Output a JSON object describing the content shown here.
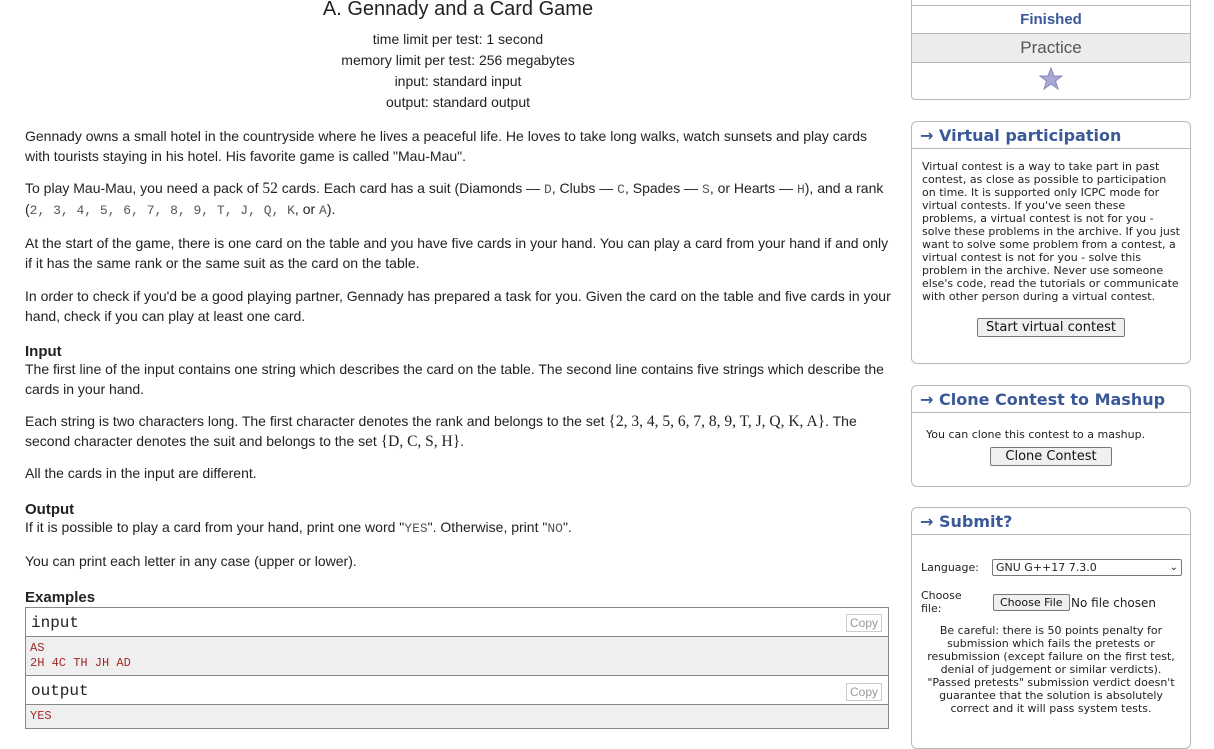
{
  "problem": {
    "title": "A. Gennady and a Card Game",
    "time_limit": "time limit per test: 1 second",
    "memory_limit": "memory limit per test: 256 megabytes",
    "input": "input: standard input",
    "output": "output: standard output"
  },
  "statement": {
    "p1": "Gennady owns a small hotel in the countryside where he lives a peaceful life. He loves to take long walks, watch sunsets and play cards with tourists staying in his hotel. His favorite game is called \"Mau-Mau\".",
    "p2_a": "To play Mau-Mau, you need a pack of ",
    "p2_52": "52",
    "p2_b": " cards. Each card has a suit (Diamonds — ",
    "p2_D": "D",
    "p2_c": ", Clubs — ",
    "p2_C": "C",
    "p2_d": ", Spades — ",
    "p2_S": "S",
    "p2_e": ", or Hearts — ",
    "p2_H": "H",
    "p2_f": "), and a rank (",
    "p2_ranks": "2, 3, 4, 5, 6, 7, 8, 9, T, J, Q, K",
    "p2_g": ", or ",
    "p2_A": "A",
    "p2_h": ").",
    "p3": "At the start of the game, there is one card on the table and you have five cards in your hand. You can play a card from your hand if and only if it has the same rank or the same suit as the card on the table.",
    "p4": "In order to check if you'd be a good playing partner, Gennady has prepared a task for you. Given the card on the table and five cards in your hand, check if you can play at least one card."
  },
  "input_section": {
    "heading": "Input",
    "p1": "The first line of the input contains one string which describes the card on the table. The second line contains five strings which describe the cards in your hand.",
    "p2_a": "Each string is two characters long. The first character denotes the rank and belongs to the set ",
    "p2_set1": "{2, 3, 4, 5, 6, 7, 8, 9, T, J, Q, K, A}",
    "p2_b": ". The second character denotes the suit and belongs to the set ",
    "p2_set2": "{D, C, S, H}",
    "p2_c": ".",
    "p3": "All the cards in the input are different."
  },
  "output_section": {
    "heading": "Output",
    "p1_a": "If it is possible to play a card from your hand, print one word \"",
    "p1_yes": "YES",
    "p1_b": "\". Otherwise, print \"",
    "p1_no": "NO",
    "p1_c": "\".",
    "p2": "You can print each letter in any case (upper or lower)."
  },
  "examples": {
    "heading": "Examples",
    "input_label": "input",
    "input_lines": [
      "AS",
      "2H 4C TH JH AD"
    ],
    "output_label": "output",
    "output_lines": [
      "YES"
    ],
    "copy_label": "Copy"
  },
  "sidebar": {
    "status": "Finished",
    "practice": "Practice",
    "virtual": {
      "title": "→ Virtual participation",
      "text": "Virtual contest is a way to take part in past contest, as close as possible to participation on time. It is supported only ICPC mode for virtual contests. If you've seen these problems, a virtual contest is not for you - solve these problems in the archive. If you just want to solve some problem from a contest, a virtual contest is not for you - solve this problem in the archive. Never use someone else's code, read the tutorials or communicate with other person during a virtual contest.",
      "button": "Start virtual contest"
    },
    "clone": {
      "title": "→ Clone Contest to Mashup",
      "text": "You can clone this contest to a mashup.",
      "button": "Clone Contest"
    },
    "submit": {
      "title": "→ Submit?",
      "language_label": "Language:",
      "language_value": "GNU G++17 7.3.0",
      "file_label": "Choose file:",
      "file_button": "Choose File",
      "file_status": "No file chosen",
      "warning": "Be careful: there is 50 points penalty for submission which fails the pretests or resubmission (except failure on the first test, denial of judgement or similar verdicts). \"Passed pretests\" submission verdict doesn't guarantee that the solution is absolutely correct and it will pass system tests."
    }
  },
  "colors": {
    "link_blue": "#3b5998",
    "sample_red": "#a02828",
    "star": "#a8a8d8"
  }
}
